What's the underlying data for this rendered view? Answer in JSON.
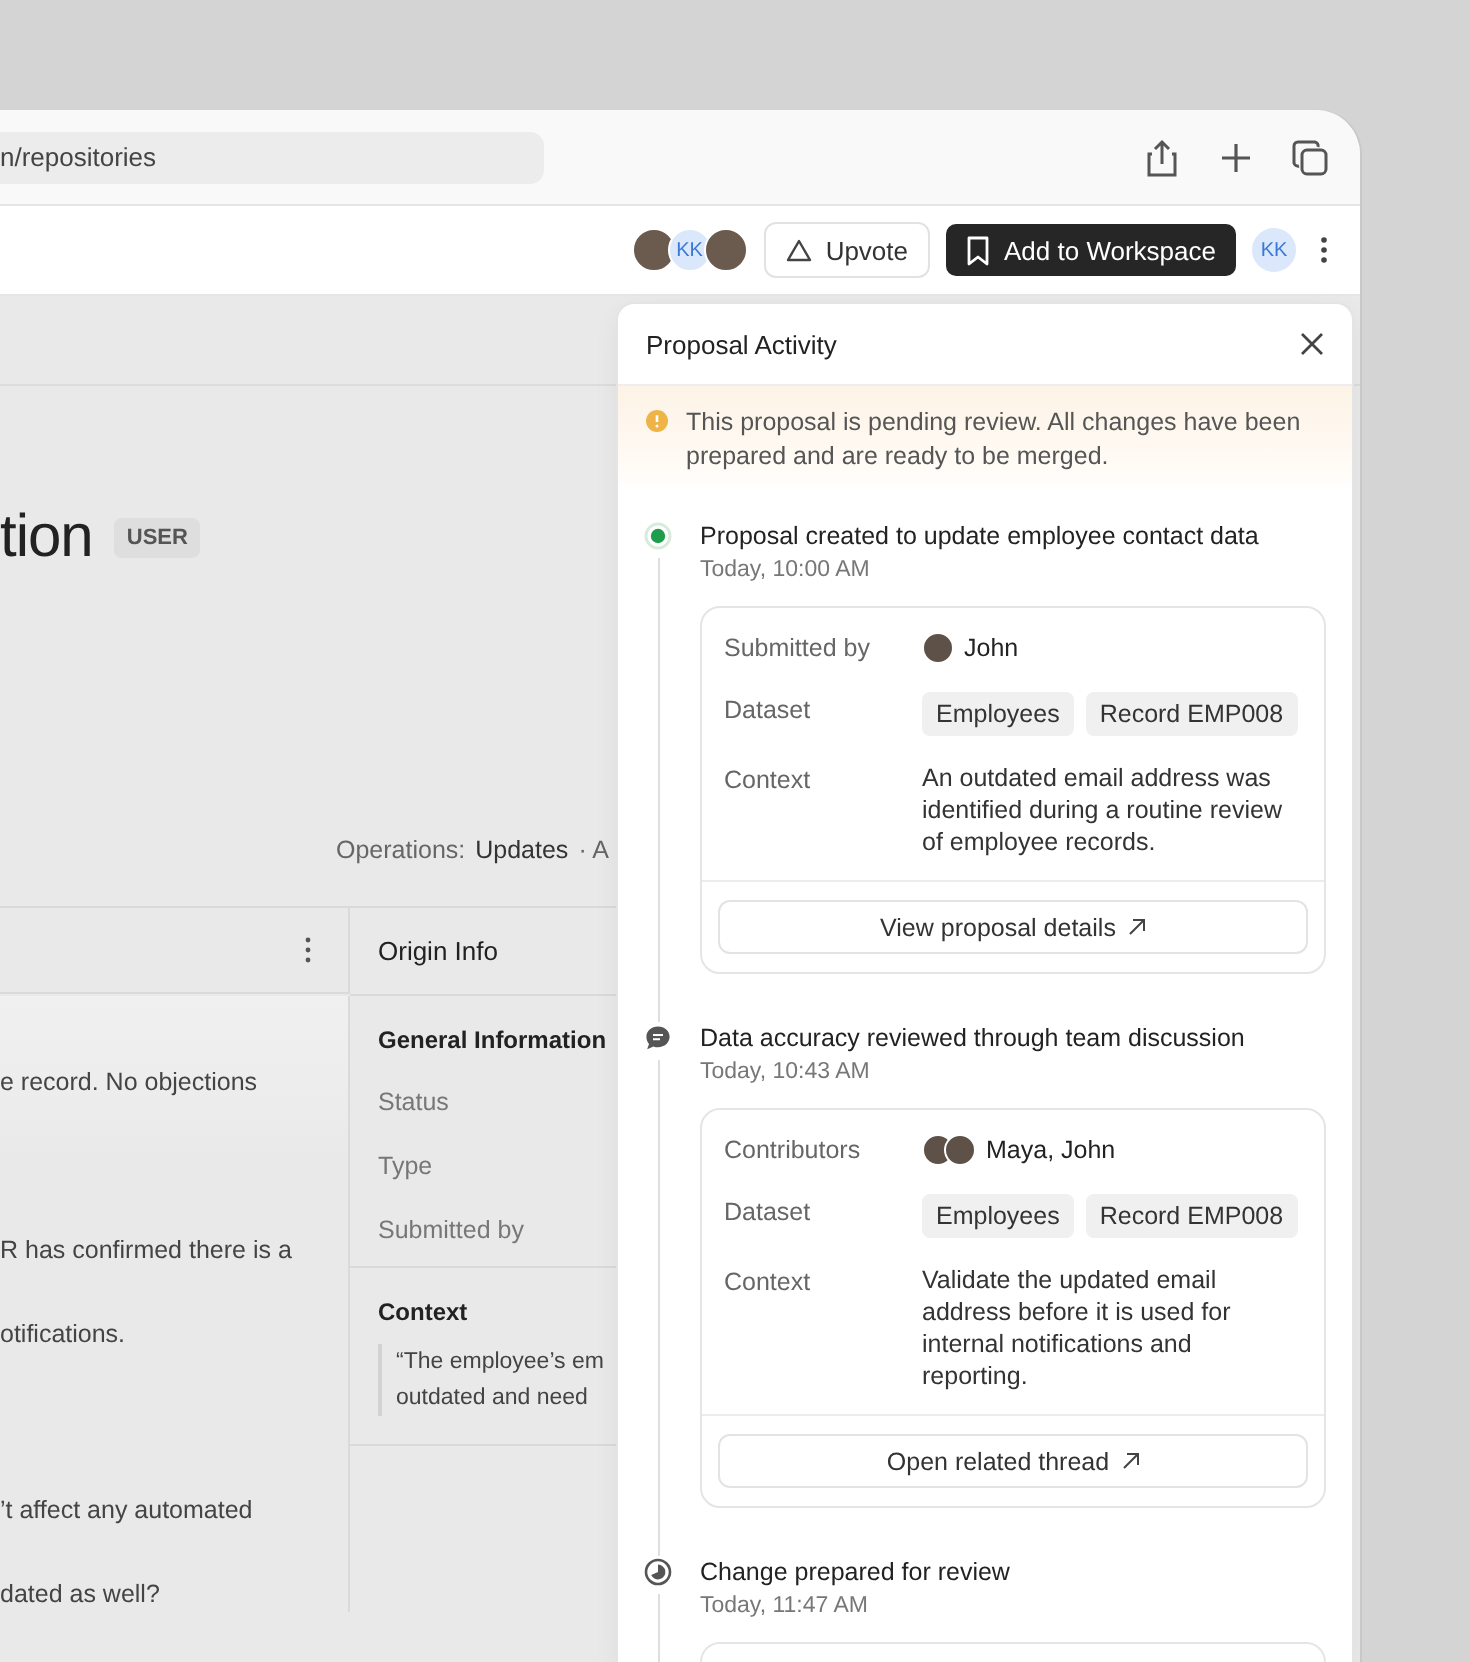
{
  "browser": {
    "address": "n/repositories"
  },
  "header": {
    "avatars": [
      {
        "kind": "photo"
      },
      {
        "kind": "initials",
        "text": "KK"
      },
      {
        "kind": "photo"
      }
    ],
    "upvote": "Upvote",
    "add_to_workspace": "Add to Workspace",
    "user": "KK"
  },
  "page": {
    "title": "tion",
    "badge": "USER",
    "operations": {
      "label": "Operations:",
      "value": "Updates",
      "more": "· A"
    },
    "table": {
      "rows": [
        {
          "text": "e record. No objections",
          "selected": true
        },
        {
          "text": "R has confirmed there is a",
          "selected": false
        },
        {
          "text": "otifications.",
          "selected": false
        },
        {
          "text": "’t affect any automated",
          "selected": false
        },
        {
          "text": "dated as well?",
          "selected": false
        }
      ],
      "origin": {
        "title": "Origin Info",
        "sections": [
          {
            "title": "General Information",
            "fields": [
              "Status",
              "Type",
              "Submitted by"
            ]
          },
          {
            "title": "Context",
            "quote": [
              "“The employee’s em",
              "outdated and need"
            ]
          }
        ]
      }
    }
  },
  "panel": {
    "title": "Proposal Activity",
    "notice": "This proposal is pending review. All changes have been prepared and are ready to be merged.",
    "events": [
      {
        "kind": "created",
        "title": "Proposal created to update employee contact data",
        "time": "Today, 10:00 AM",
        "card": {
          "rows": [
            {
              "kind": "people",
              "label": "Submitted by",
              "avatars": [
                {
                  "kind": "photo"
                }
              ],
              "value": "John"
            },
            {
              "kind": "tags",
              "label": "Dataset",
              "tags": [
                "Employees",
                "Record EMP008"
              ]
            },
            {
              "kind": "text",
              "label": "Context",
              "value": "An outdated email address was identified during a routine review of employee records."
            }
          ],
          "action": "View proposal details"
        }
      },
      {
        "kind": "discussion",
        "title": "Data accuracy reviewed through team discussion",
        "time": "Today, 10:43 AM",
        "card": {
          "rows": [
            {
              "kind": "people",
              "label": "Contributors",
              "avatars": [
                {
                  "kind": "photo"
                },
                {
                  "kind": "photo"
                }
              ],
              "value": "Maya, John"
            },
            {
              "kind": "tags",
              "label": "Dataset",
              "tags": [
                "Employees",
                "Record EMP008"
              ]
            },
            {
              "kind": "text",
              "label": "Context",
              "value": "Validate the updated email address before it is used for internal notifications and reporting."
            }
          ],
          "action": "Open related thread"
        }
      },
      {
        "kind": "prepared",
        "title": "Change prepared for review",
        "time": "Today, 11:47 AM"
      }
    ]
  }
}
